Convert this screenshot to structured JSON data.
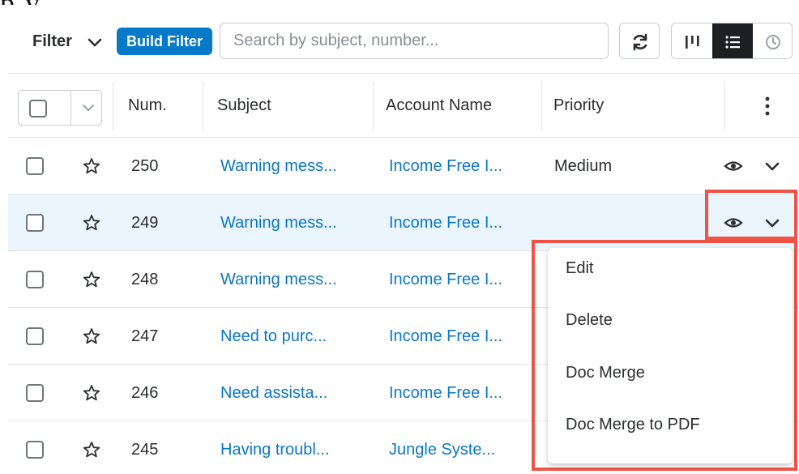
{
  "toolbar": {
    "filter_label": "Filter",
    "build_filter_label": "Build Filter",
    "search_placeholder": "Search by subject, number..."
  },
  "table": {
    "columns": [
      "Num.",
      "Subject",
      "Account Name",
      "Priority"
    ],
    "rows": [
      {
        "num": "250",
        "subject": "Warning mess...",
        "account": "Income Free I...",
        "priority": "Medium"
      },
      {
        "num": "249",
        "subject": "Warning mess...",
        "account": "Income Free I...",
        "priority": ""
      },
      {
        "num": "248",
        "subject": "Warning mess...",
        "account": "Income Free I...",
        "priority": ""
      },
      {
        "num": "247",
        "subject": "Need to purc...",
        "account": "Income Free I...",
        "priority": ""
      },
      {
        "num": "246",
        "subject": "Need assista...",
        "account": "Income Free I...",
        "priority": ""
      },
      {
        "num": "245",
        "subject": "Having troubl...",
        "account": "Jungle Syste...",
        "priority": ""
      }
    ]
  },
  "row_menu": {
    "items": [
      "Edit",
      "Delete",
      "Doc Merge",
      "Doc Merge to PDF"
    ]
  },
  "colors": {
    "accent": "#0679c8",
    "link": "#0b78c4",
    "highlight_row": "#ebf5fd",
    "callout": "#ef5346"
  },
  "icons": {
    "filter_dropdown": "chevron-down-icon",
    "refresh": "refresh-icon",
    "kanban_view": "kanban-icon",
    "list_view": "list-icon",
    "activity_view": "clock-icon",
    "row_preview": "eye-icon",
    "row_actions": "chevron-down-icon",
    "favorite": "star-icon",
    "column_options": "kebab-icon"
  }
}
